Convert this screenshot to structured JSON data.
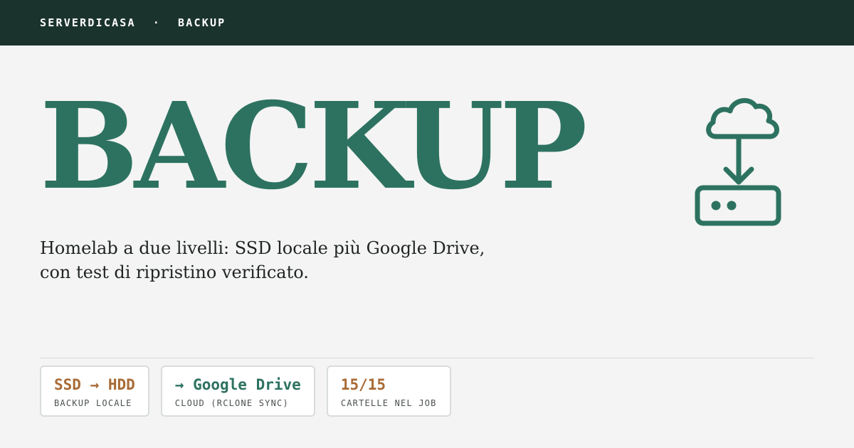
{
  "topbar": {
    "site": "SERVERDICASA",
    "separator": "·",
    "section": "BACKUP"
  },
  "hero": {
    "title": "BACKUP",
    "icon": "cloud-download-to-drive-icon",
    "subtitle_line1": "Homelab a due livelli: SSD locale più Google Drive,",
    "subtitle_line2": "con test di ripristino verificato."
  },
  "stats": [
    {
      "value": "SSD → HDD",
      "label": "BACKUP LOCALE"
    },
    {
      "value": "→ Google Drive",
      "label": "CLOUD (RCLONE SYNC)"
    },
    {
      "value": "15/15",
      "label": "CARTELLE NEL JOB"
    }
  ],
  "colors": {
    "topbar_bg": "#1b332d",
    "accent_green": "#2d7260",
    "accent_brown": "#a86a35",
    "page_bg": "#f3f4f3"
  }
}
